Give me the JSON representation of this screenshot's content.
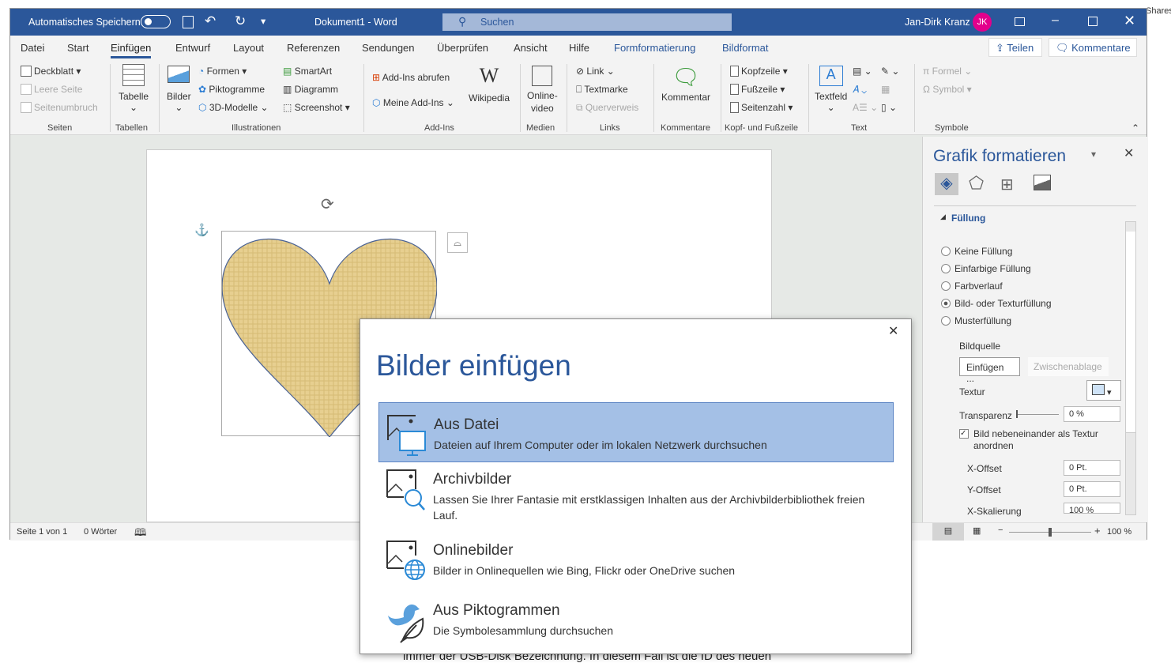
{
  "titlebar": {
    "autosave": "Automatisches Speichern",
    "doc": "Dokument1  -  Word",
    "search": "Suchen",
    "user": "Jan-Dirk Kranz",
    "initials": "JK",
    "shares": "Shares"
  },
  "tabs": [
    "Datei",
    "Start",
    "Einfügen",
    "Entwurf",
    "Layout",
    "Referenzen",
    "Sendungen",
    "Überprüfen",
    "Ansicht",
    "Hilfe",
    "Formformatierung",
    "Bildformat"
  ],
  "share": "Teilen",
  "comments": "Kommentare",
  "ribbon": {
    "deckblatt": "Deckblatt",
    "leere": "Leere Seite",
    "umbruch": "Seitenumbruch",
    "seiten": "Seiten",
    "tabelle": "Tabelle",
    "tabellen": "Tabellen",
    "bilder": "Bilder",
    "formen": "Formen",
    "pikto": "Piktogramme",
    "modelle": "3D-Modelle",
    "smartart": "SmartArt",
    "diagramm": "Diagramm",
    "screenshot": "Screenshot",
    "illustrationen": "Illustrationen",
    "addins_get": "Add-Ins abrufen",
    "meine": "Meine Add-Ins",
    "wikipedia": "Wikipedia",
    "addins": "Add-Ins",
    "online1": "Online-",
    "online2": "video",
    "medien": "Medien",
    "link": "Link",
    "textmarke": "Textmarke",
    "querverweis": "Querverweis",
    "links": "Links",
    "kommentar": "Kommentar",
    "kommentare": "Kommentare",
    "kopf": "Kopfzeile",
    "fuss": "Fußzeile",
    "seitenzahl": "Seitenzahl",
    "kopffuss": "Kopf- und Fußzeile",
    "textfeld": "Textfeld",
    "text": "Text",
    "formel": "Formel",
    "symbol": "Symbol",
    "symbole": "Symbole"
  },
  "pane": {
    "title": "Grafik formatieren",
    "section": "Füllung",
    "options": [
      "Keine Füllung",
      "Einfarbige Füllung",
      "Farbverlauf",
      "Bild- oder Texturfüllung",
      "Musterfüllung"
    ],
    "selected": 3,
    "bildquelle": "Bildquelle",
    "einfuegen": "Einfügen ...",
    "zwischen": "Zwischenablage",
    "textur": "Textur",
    "transparenz": "Transparenz",
    "transparenz_val": "0 %",
    "tile": "Bild nebeneinander als Textur anordnen",
    "tile_checked": true,
    "xoff": "X-Offset",
    "xoff_val": "0 Pt.",
    "yoff": "Y-Offset",
    "yoff_val": "0 Pt.",
    "xskal": "X-Skalierung",
    "xskal_val": "100 %"
  },
  "status": {
    "page": "Seite 1 von 1",
    "words": "0 Wörter",
    "zoom": "100 %",
    "zoom_percent": 100
  },
  "dialog": {
    "title": "Bilder einfügen",
    "items": [
      {
        "title": "Aus Datei",
        "desc": "Dateien auf Ihrem Computer oder im lokalen Netzwerk durchsuchen"
      },
      {
        "title": "Archivbilder",
        "desc": "Lassen Sie Ihrer Fantasie mit erstklassigen Inhalten aus der Archivbilderbibliothek freien Lauf."
      },
      {
        "title": "Onlinebilder",
        "desc": "Bilder in Onlinequellen wie Bing, Flickr oder OneDrive suchen"
      },
      {
        "title": "Aus Piktogrammen",
        "desc": "Die Symbolesammlung durchsuchen"
      }
    ]
  },
  "background_text": "immer der USB-Disk Bezeichnung. In diesem Fall ist die ID des neuen",
  "colors": {
    "accent": "#2b579a",
    "selected": "#a4c0e6",
    "avatar": "#e3008c"
  }
}
